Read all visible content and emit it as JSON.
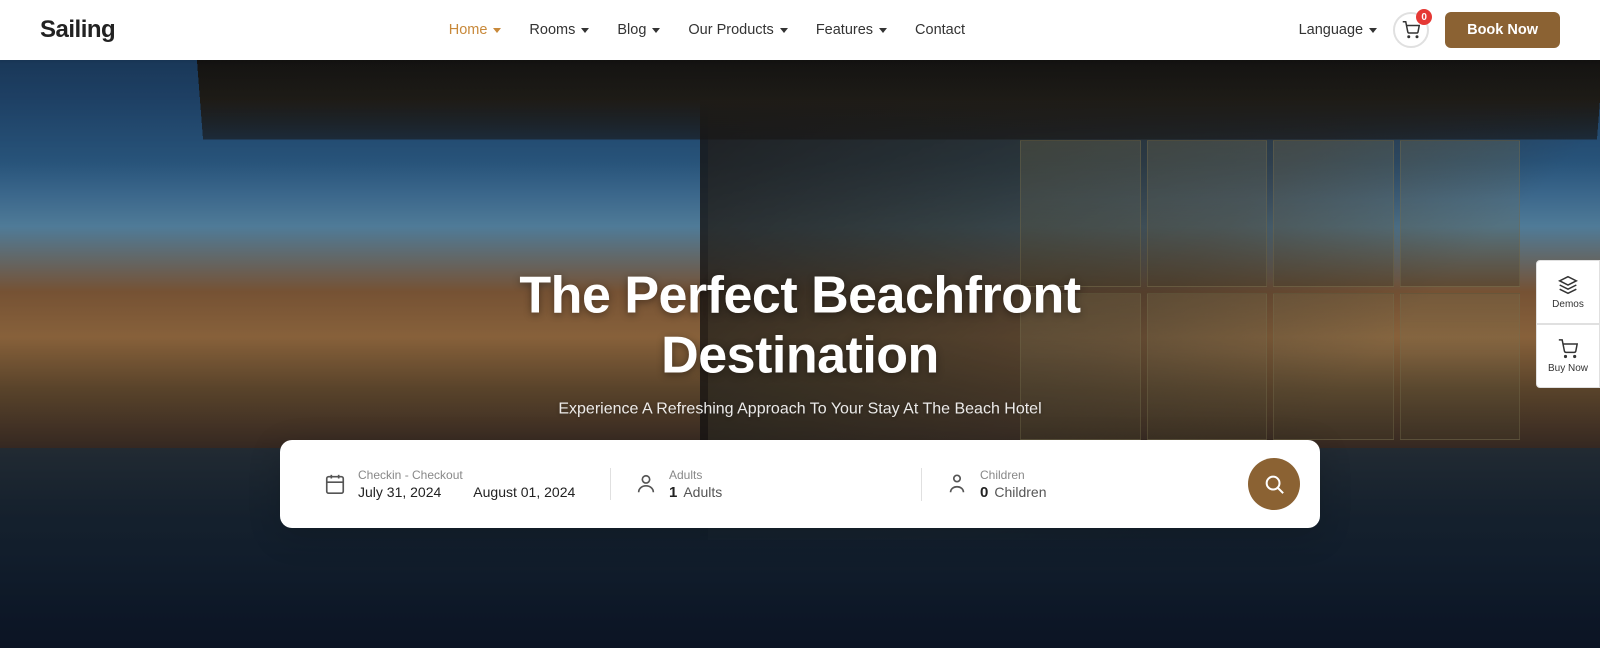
{
  "brand": {
    "logo": "Sailing"
  },
  "navbar": {
    "links": [
      {
        "label": "Home",
        "active": true,
        "hasDropdown": true
      },
      {
        "label": "Rooms",
        "active": false,
        "hasDropdown": true
      },
      {
        "label": "Blog",
        "active": false,
        "hasDropdown": true
      },
      {
        "label": "Our Products",
        "active": false,
        "hasDropdown": true
      },
      {
        "label": "Features",
        "active": false,
        "hasDropdown": true
      },
      {
        "label": "Contact",
        "active": false,
        "hasDropdown": false
      }
    ],
    "language_label": "Language",
    "cart_count": "0",
    "book_label": "Book Now"
  },
  "hero": {
    "title": "The Perfect Beachfront Destination",
    "subtitle": "Experience A Refreshing Approach To Your Stay At The Beach Hotel"
  },
  "search": {
    "checkin_label": "Checkin - Checkout",
    "checkin_date": "July 31, 2024",
    "checkout_date": "August 01, 2024",
    "adults_label": "Adults",
    "adults_count": "1",
    "adults_text": "Adults",
    "children_label": "Children",
    "children_count": "0",
    "children_text": "Children"
  },
  "side_widgets": [
    {
      "label": "Demos",
      "icon": "layers-icon"
    },
    {
      "label": "Buy Now",
      "icon": "cart-icon"
    }
  ]
}
